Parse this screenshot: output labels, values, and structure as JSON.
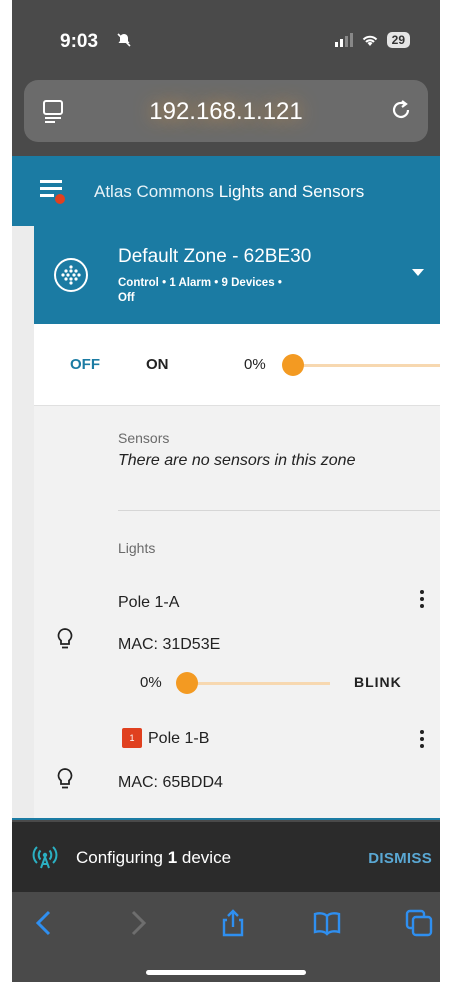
{
  "status_bar": {
    "time": "9:03",
    "battery": "29"
  },
  "browser": {
    "url": "192.168.1.121"
  },
  "app": {
    "title_prefix": "Atlas Commons",
    "title_suffix": "Lights and Sensors",
    "accent_color": "#1b7ba3",
    "slider_color": "#f39a22"
  },
  "zone": {
    "title": "Default Zone - 62BE30",
    "meta_control": "Control",
    "meta_alarms": "1 Alarm",
    "meta_devices": "9 Devices",
    "meta_state": "Off",
    "separator": "•"
  },
  "controls": {
    "off_label": "OFF",
    "on_label": "ON",
    "level_text": "0%",
    "level_value": 0
  },
  "sensors": {
    "label": "Sensors",
    "empty_text": "There are no sensors in this zone"
  },
  "lights": {
    "label": "Lights",
    "mac_prefix": "MAC:",
    "items": [
      {
        "name": "Pole 1-A",
        "mac": "31D53E",
        "level_text": "0%",
        "level_value": 0,
        "action": "BLINK"
      },
      {
        "name": "Pole 1-B",
        "mac": "65BDD4",
        "alarm_count": "1"
      }
    ]
  },
  "snackbar": {
    "prefix": "Configuring",
    "count": "1",
    "suffix": "device",
    "dismiss_label": "DISMISS"
  }
}
